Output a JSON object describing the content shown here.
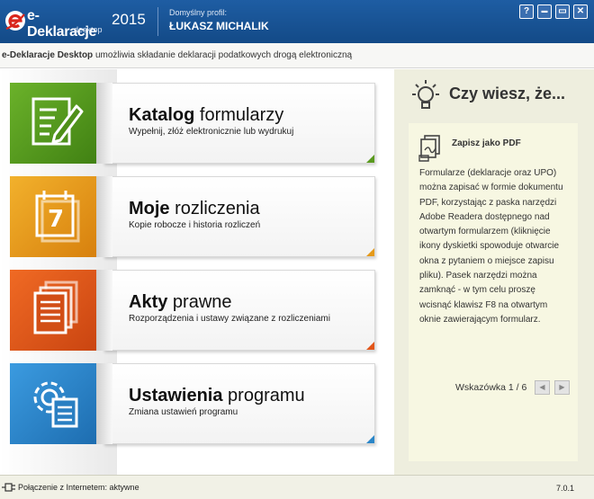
{
  "titlebar": {
    "brand": "e-Deklaracje",
    "brand_sub": "desktop",
    "year": "2015",
    "profile_label": "Domyślny profil:",
    "profile_name": "ŁUKASZ MICHALIK",
    "buttons": {
      "help": "?",
      "minimize": "▬",
      "maximize": "▭",
      "close": "✕"
    }
  },
  "subbar": {
    "app_name": "e-Deklaracje Desktop",
    "text": " umożliwia składanie deklaracji podatkowych drogą elektroniczną"
  },
  "tiles": [
    {
      "title_bold": "Katalog",
      "title_rest": " formularzy",
      "desc": "Wypełnij, złóż elektronicznie lub wydrukuj",
      "color": "#5a9a1f",
      "icon": "form-edit-icon"
    },
    {
      "title_bold": "Moje",
      "title_rest": " rozliczenia",
      "desc": "Kopie robocze i historia rozliczeń",
      "color": "#e59a1a",
      "icon": "calendar-icon"
    },
    {
      "title_bold": "Akty",
      "title_rest": " prawne",
      "desc": "Rozporządzenia i ustawy związane z rozliczeniami",
      "color": "#e2561a",
      "icon": "documents-icon"
    },
    {
      "title_bold": "Ustawienia",
      "title_rest": " programu",
      "desc": "Zmiana ustawień programu",
      "color": "#2a86c8",
      "icon": "settings-gear-icon"
    }
  ],
  "calendar_day": "7",
  "side": {
    "heading": "Czy wiesz, że...",
    "tip_title": "Zapisz jako PDF",
    "tip_text": "Formularze (deklaracje oraz UPO) można zapisać w formie dokumentu PDF, korzystając z paska narzędzi Adobe Readera dostępnego nad otwartym formularzem (kliknięcie ikony dyskietki spowoduje otwarcie okna z pytaniem o miejsce zapisu pliku). Pasek narzędzi można zamknąć - w tym celu proszę wcisnąć klawisz F8 na otwartym oknie zawierającym formularz.",
    "counter": "Wskazówka 1 / 6",
    "prev": "◀",
    "next": "▶"
  },
  "status": {
    "connection": "Połączenie z Internetem: aktywne",
    "version": "7.0.1"
  }
}
